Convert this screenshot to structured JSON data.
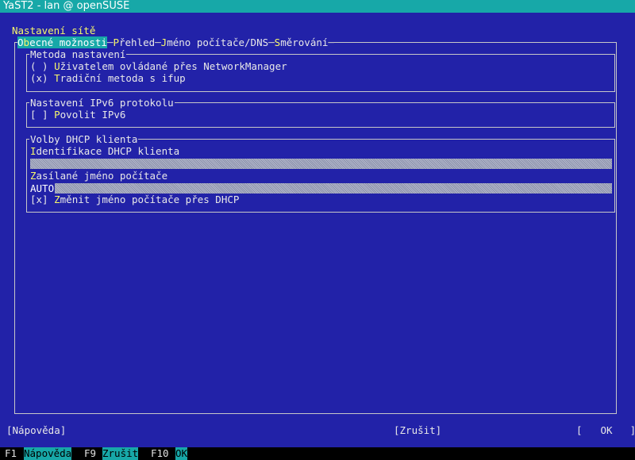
{
  "window": {
    "title": "YaST2 - lan @ openSUSE"
  },
  "dialog": {
    "title": "Nastavení sítě"
  },
  "tabs": [
    {
      "label": "Obecné možnosti",
      "active": true
    },
    {
      "label": "Přehled",
      "active": false
    },
    {
      "label": "Jméno počítače/DNS",
      "active": false
    },
    {
      "label": "Směrování",
      "active": false
    }
  ],
  "setup_method": {
    "legend": "Metoda nastavení",
    "options": [
      {
        "marker": "( )",
        "label": "Uživatelem ovládané přes NetworkManager",
        "selected": false
      },
      {
        "marker": "(x)",
        "label": "Tradiční metoda s ifup",
        "selected": true
      }
    ]
  },
  "ipv6": {
    "legend": "Nastavení IPv6 protokolu",
    "checkbox_marker": "[ ]",
    "checkbox_label": "Povolit IPv6",
    "checked": false
  },
  "dhcp": {
    "legend": "Volby DHCP klienta",
    "client_id_label": "Identifikace DHCP klienta",
    "client_id_value": "",
    "hostname_label": "Zasílané jméno počítače",
    "hostname_value": "AUTO",
    "change_hostname_marker": "[x]",
    "change_hostname_label": "Změnit jméno počítače přes DHCP",
    "change_hostname_checked": true
  },
  "buttons": {
    "help": "[Nápověda]",
    "cancel": "[Zrušit]",
    "ok_open": "[",
    "ok": "OK",
    "ok_close": "]"
  },
  "fkeys": [
    {
      "key": "F1",
      "label": "Nápověda"
    },
    {
      "key": "F9",
      "label": "Zrušit"
    },
    {
      "key": "F10",
      "label": "OK"
    }
  ],
  "colors": {
    "background": "#2222a8",
    "accent": "#17a8a8",
    "highlight": "#f8f86a"
  }
}
